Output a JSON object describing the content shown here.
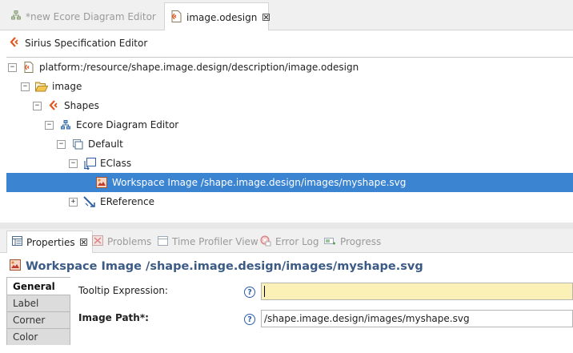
{
  "editor_tabs": [
    {
      "label": "*new Ecore Diagram Editor",
      "active": false,
      "icon": "diagram-icon"
    },
    {
      "label": "image.odesign",
      "active": true,
      "icon": "odesign-file-icon"
    }
  ],
  "editor": {
    "title": "Sirius Specification Editor",
    "tree": [
      {
        "label": "platform:/resource/shape.image.design/description/image.odesign",
        "toggle": "−",
        "icon": "resource-file-icon"
      },
      {
        "label": "image",
        "toggle": "−",
        "icon": "folder-open-icon"
      },
      {
        "label": "Shapes",
        "toggle": "−",
        "icon": "viewpoint-icon"
      },
      {
        "label": "Ecore Diagram Editor",
        "toggle": "−",
        "icon": "diagram-icon"
      },
      {
        "label": "Default",
        "toggle": "−",
        "icon": "layer-icon"
      },
      {
        "label": "EClass",
        "toggle": "−",
        "icon": "node-mapping-icon"
      },
      {
        "label": "Workspace Image /shape.image.design/images/myshape.svg",
        "toggle": "",
        "icon": "workspace-image-icon",
        "selected": true
      },
      {
        "label": "EReference",
        "toggle": "+",
        "icon": "edge-mapping-icon"
      }
    ]
  },
  "view_tabs": [
    {
      "label": "Properties",
      "active": true,
      "icon": "properties-icon"
    },
    {
      "label": "Problems",
      "active": false,
      "icon": "problems-icon"
    },
    {
      "label": "Time Profiler View",
      "active": false,
      "icon": "time-profiler-icon"
    },
    {
      "label": "Error Log",
      "active": false,
      "icon": "error-log-icon"
    },
    {
      "label": "Progress",
      "active": false,
      "icon": "progress-icon"
    }
  ],
  "properties": {
    "title": "Workspace Image /shape.image.design/images/myshape.svg",
    "tabs": [
      "General",
      "Label",
      "Corner",
      "Color"
    ],
    "active_tab": "General",
    "fields": {
      "tooltip_label": "Tooltip Expression:",
      "tooltip_value": "",
      "image_path_label": "Image Path*:",
      "image_path_value": "/shape.image.design/images/myshape.svg"
    },
    "help_glyph": "?"
  },
  "colors": {
    "selection": "#3a84d1",
    "title_blue": "#3b5b86",
    "tooltip_field": "#fbf1b7",
    "sirius_orange": "#e0571f"
  }
}
